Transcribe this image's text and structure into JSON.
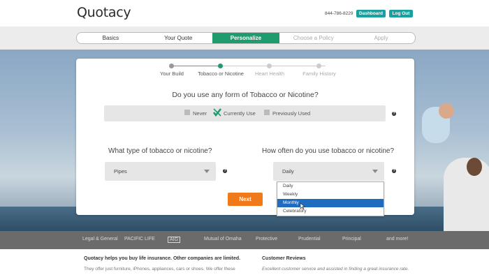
{
  "header": {
    "logo": "Quotacy",
    "phone": "844-786-8229",
    "dashboard_label": "Dashboard",
    "logout_label": "Log Out"
  },
  "progress": {
    "steps": [
      "Basics",
      "Your Quote",
      "Personalize",
      "Choose a Policy",
      "Apply"
    ],
    "active_index": 2
  },
  "substeps": {
    "items": [
      "Your Build",
      "Tobacco or Nicotine",
      "Heart Health",
      "Family History"
    ],
    "active_index": 1
  },
  "question_main": "Do you use any form of Tobacco or Nicotine?",
  "options": {
    "never": "Never",
    "current": "Currently Use",
    "previous": "Previously Used",
    "selected": "Currently Use"
  },
  "type_question": "What type of tobacco or nicotine?",
  "type_select": {
    "value": "Pipes"
  },
  "frequency_question": "How often do you use tobacco or nicotine?",
  "frequency_select": {
    "value": "Daily",
    "options": [
      "Daily",
      "Weekly",
      "Monthly",
      "Celebratory"
    ],
    "highlighted": "Monthly"
  },
  "next_label": "Next",
  "carriers": [
    "Legal & General",
    "PACIFIC LIFE",
    "AIG",
    "Mutual of Omaha",
    "Protective",
    "Prudential",
    "Principal",
    "and more!"
  ],
  "footer": {
    "left_title": "Quotacy helps you buy life insurance. Other companies are limited.",
    "left_text": "They offer just furniture, iPhones, appliances, cars or shoes. We offer these",
    "right_title": "Customer Reviews",
    "right_text": "Excellent customer service and assisted in finding a great insurance rate."
  },
  "colors": {
    "accent_teal": "#1aa0a0",
    "accent_green": "#1f9c6e",
    "next_orange": "#f07a1a",
    "highlight_blue": "#1f6bbf"
  }
}
